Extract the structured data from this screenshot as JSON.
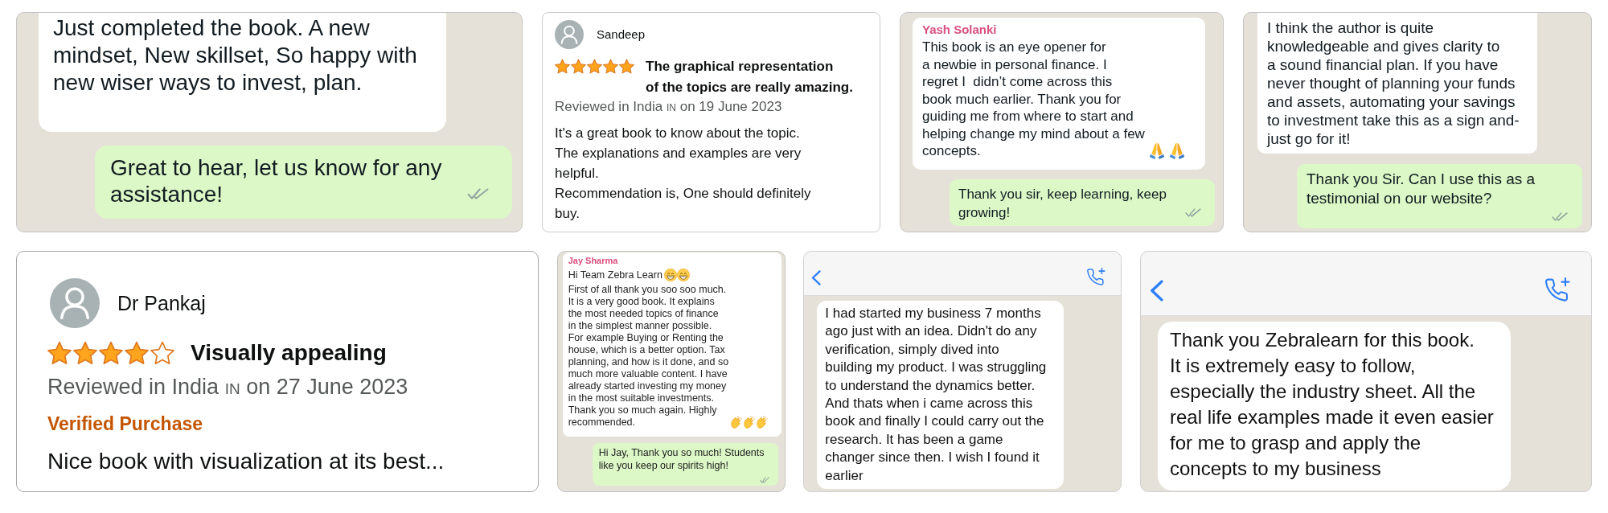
{
  "rows": [
    {
      "cards": [
        {
          "kind": "chat",
          "messages": [
            {
              "kind": "incoming",
              "paragraphs": [
                {
                  "text": "Just completed the book. A new\nmindset, New skillset, So happy with\nnew wiser ways to invest, plan."
                }
              ]
            },
            {
              "kind": "outgoing",
              "paragraphs": [
                {
                  "text": "Great to hear, let us know for any\nassistance!"
                }
              ]
            }
          ]
        },
        {
          "kind": "review",
          "reviewer": "Sandeep",
          "stars": 5,
          "title": "The graphical representation\nof the topics are really amazing.",
          "review_place": "Reviewed in India",
          "country": "IN",
          "review_date": "on 19 June 2023",
          "body": "It's a great book to know about the topic.\nThe explanations and examples are very\nhelpful.\nRecommendation is, One should definitely\nbuy."
        },
        {
          "kind": "chat",
          "messages": [
            {
              "kind": "incoming",
              "sender": "Yash Solanki",
              "paragraphs": [
                {
                  "text": "This book is an eye opener for\na newbie in personal finance. I\nregret I  didn’t come across this\nbook much earlier. Thank you for\nguiding me from where to start and\nhelping change my mind about a few\nconcepts.",
                  "emojis": [
                    {
                      "kind": "folded_hands"
                    },
                    {
                      "kind": "folded_hands"
                    }
                  ]
                }
              ]
            },
            {
              "kind": "outgoing",
              "paragraphs": [
                {
                  "text": "Thank you sir, keep learning, keep\ngrowing!"
                }
              ]
            }
          ]
        },
        {
          "kind": "chat",
          "messages": [
            {
              "kind": "incoming",
              "paragraphs": [
                {
                  "text": "I think the author is quite\nknowledgeable and gives clarity to\na sound financial plan. If you have\nnever thought of planning your funds\nand assets, automating your savings\nto investment take this as a sign and-\njust go for it!"
                }
              ]
            },
            {
              "kind": "outgoing",
              "paragraphs": [
                {
                  "text": "Thank you Sir. Can I use this as a\ntestimonial on our website?"
                }
              ]
            }
          ]
        }
      ]
    },
    {
      "cards": [
        {
          "kind": "review",
          "reviewer": "Dr Pankaj",
          "stars": 4,
          "title": "Visually appealing",
          "review_place": "Reviewed in India",
          "country": "IN",
          "review_date": "on 27 June 2023",
          "badge": "Verified Purchase",
          "body": "Nice book with visualization at its best..."
        },
        {
          "kind": "chat",
          "messages": [
            {
              "kind": "incoming",
              "sender": "Jay Sharma",
              "paragraphs": [
                {
                  "text": "Hi Team Zebra Learn",
                  "emojis": [
                    {
                      "kind": "grinning_face"
                    },
                    {
                      "kind": "grinning_face"
                    }
                  ]
                },
                {
                  "text": "First of all thank you soo soo much.\nIt is a very good book. It explains\nthe most needed topics of finance\nin the simplest manner possible.\nFor example Buying or Renting the\nhouse, which is a better option. Tax\nplanning, and how is it done, and so\nmuch more valuable content. I have\nalready started investing my money\nin the most suitable investments.\nThank you so much again. Highly\nrecommended.",
                  "emojis": [
                    {
                      "kind": "clapping_hands"
                    },
                    {
                      "kind": "clapping_hands"
                    },
                    {
                      "kind": "clapping_hands"
                    }
                  ]
                }
              ]
            },
            {
              "kind": "outgoing",
              "paragraphs": [
                {
                  "text": "Hi Jay, Thank you so much! Students\nlike you keep our spirits high!"
                }
              ]
            }
          ]
        },
        {
          "kind": "header_chat",
          "messages": [
            {
              "kind": "incoming",
              "paragraphs": [
                {
                  "text": "I had started my business 7 months\nago just with an idea. Didn't do any\nverification, simply dived into\nbuilding my product. I was struggling\nto understand the dynamics better.\nAnd thats when i came across this\nbook and finally I could carry out the\nresearch. It has been a game\nchanger since then. I wish I found it\nearlier"
                }
              ]
            }
          ]
        },
        {
          "kind": "header_chat",
          "messages": [
            {
              "kind": "incoming",
              "paragraphs": [
                {
                  "text": "Thank you Zebralearn for this book.\nIt is extremely easy to follow,\nespecially the industry sheet. All the\nreal life examples made it even easier\nfor me to grasp and apply the\nconcepts to my business"
                }
              ]
            }
          ]
        }
      ]
    }
  ]
}
